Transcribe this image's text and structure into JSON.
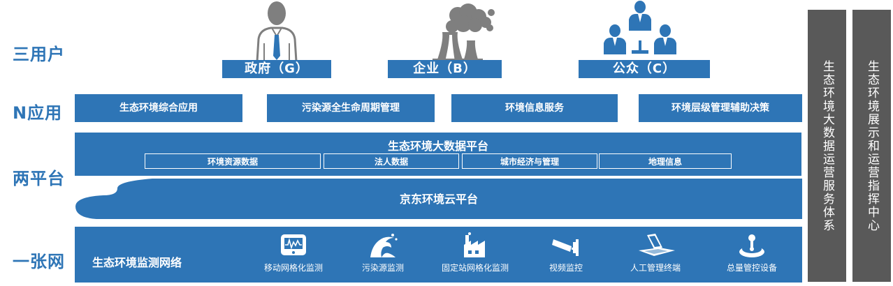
{
  "row_labels": {
    "users": "三用户",
    "apps": "N应用",
    "platforms": "两平台",
    "network": "一张网"
  },
  "users": [
    {
      "label": "政府（G）",
      "icon": "government-official-icon"
    },
    {
      "label": "企业（B）",
      "icon": "factory-smokestack-icon"
    },
    {
      "label": "公众（C）",
      "icon": "public-people-icon"
    }
  ],
  "apps": [
    "生态环境综合应用",
    "污染源全生命周期管理",
    "环境信息服务",
    "环境层级管理辅助决策"
  ],
  "big_data_platform": {
    "title": "生态环境大数据平台",
    "items": [
      "环境资源数据",
      "法人数据",
      "城市经济与管理",
      "地理信息"
    ]
  },
  "cloud_platform": {
    "title": "京东环境云平台"
  },
  "monitoring_network": {
    "title": "生态环境监测网络",
    "devices": [
      {
        "label": "移动网格化监测",
        "icon": "mobile-monitor-icon"
      },
      {
        "label": "污染源监测",
        "icon": "pollution-wave-icon"
      },
      {
        "label": "固定站网格化监测",
        "icon": "fixed-station-icon"
      },
      {
        "label": "视频监控",
        "icon": "camera-icon"
      },
      {
        "label": "人工管理终端",
        "icon": "laptop-icon"
      },
      {
        "label": "总量管控设备",
        "icon": "joystick-icon"
      }
    ]
  },
  "side_panels": [
    "生态环境大数据运营服务体系",
    "生态环境展示和运营指挥中心"
  ],
  "colors": {
    "primary_blue": "#2e75b6",
    "side_gray": "#595959",
    "icon_gray": "#7f7f7f"
  }
}
